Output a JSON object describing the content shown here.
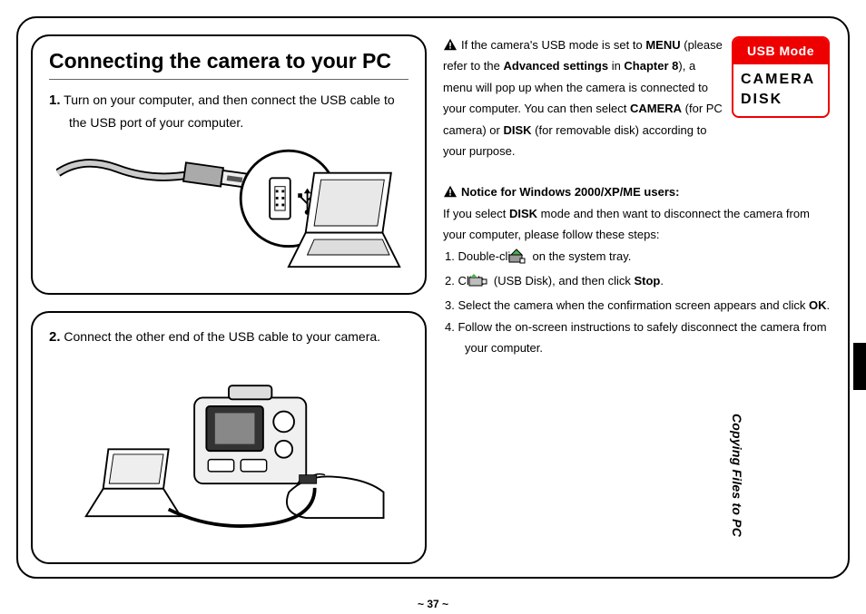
{
  "title": "Connecting the camera to your PC",
  "step1": {
    "num": "1.",
    "text": "Turn on your computer, and then connect the USB cable to the USB port of your computer."
  },
  "step2": {
    "num": "2.",
    "text": "Connect the other end of the USB cable to your camera."
  },
  "note1": {
    "pre": "If the camera's USB mode is set to ",
    "menu": "MENU",
    "mid1": " (please refer to the ",
    "adv": "Advanced settings",
    "mid2": " in ",
    "chap": "Chapter 8",
    "mid3": "), a menu will pop up when the camera is connected to your computer. You can then select ",
    "camera": "CAMERA",
    "mid4": " (for PC camera) or ",
    "disk": "DISK",
    "mid5": " (for removable disk) according to your purpose."
  },
  "usb_box": {
    "header": "USB Mode",
    "line1": "CAMERA",
    "line2": "DISK"
  },
  "note2": {
    "heading": "Notice for Windows 2000/XP/ME users:",
    "intro_a": "If you select ",
    "intro_disk": "DISK",
    "intro_b": " mode and then want to disconnect the camera from your computer, please follow these steps:",
    "s1a": "1. Double-click ",
    "s1b": " on the system tray.",
    "s2a": "2. Click ",
    "s2b": " (USB Disk), and then click ",
    "s2_stop": "Stop",
    "s2c": ".",
    "s3a": "3. Select the camera when the confirmation screen appears and click ",
    "s3_ok": "OK",
    "s3b": ".",
    "s4": "4. Follow the on-screen instructions to safely disconnect the camera from your computer."
  },
  "page_number": "~ 37 ~",
  "side_label": "Copying Files to PC"
}
